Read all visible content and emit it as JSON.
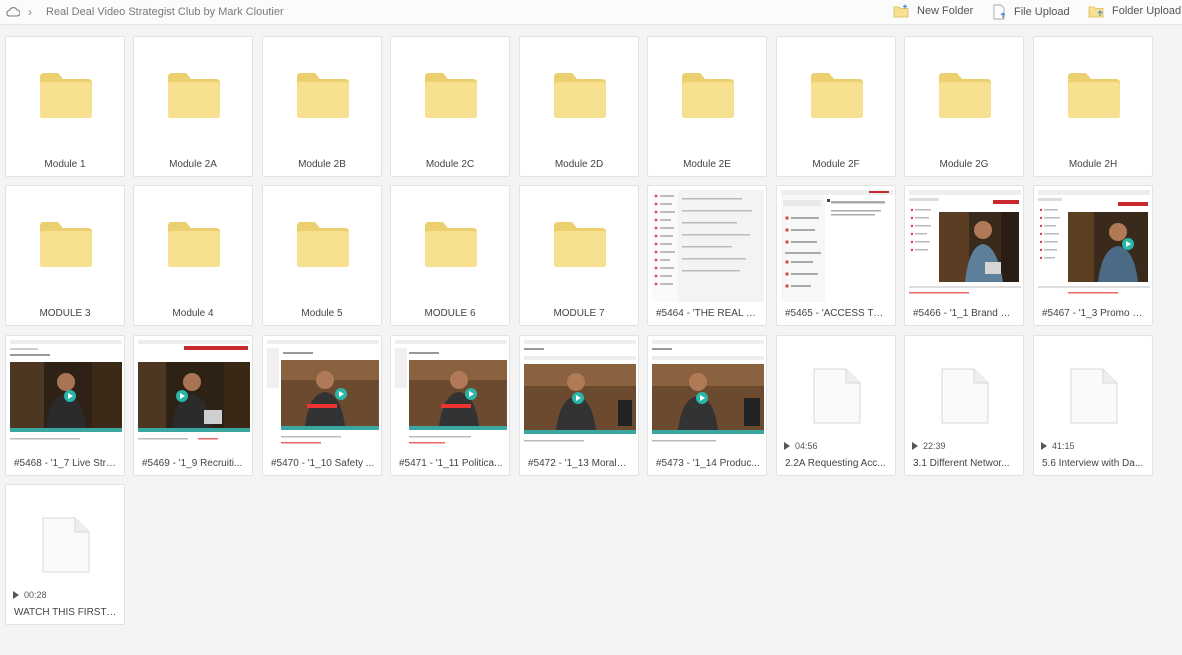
{
  "breadcrumb": {
    "title": "Real Deal Video Strategist Club by Mark Cloutier"
  },
  "toolbar": {
    "new_folder": "New Folder",
    "file_upload": "File Upload",
    "folder_upload": "Folder Upload"
  },
  "colors": {
    "folder": "#f7e08f",
    "folder_dark": "#eccf6e",
    "accent_red": "#c8282d",
    "teal": "#3aa7a0",
    "play_teal": "#29b6a8"
  },
  "folders_row1": [
    "Module 1",
    "Module 2A",
    "Module 2B",
    "Module 2C",
    "Module 2D",
    "Module 2E",
    "Module 2F",
    "Module 2G",
    "Module 2H"
  ],
  "folders_row2": [
    "MODULE 3",
    "Module 4",
    "Module 5",
    "MODULE 6",
    "MODULE 7"
  ],
  "docs_row2": [
    "#5464 - 'THE REAL D...",
    "#5465 - 'ACCESS TO ..."
  ],
  "videos_row2": [
    "#5466 - '1_1 Brand M...",
    "#5467 - '1_3 Promo V..."
  ],
  "videos_row3": [
    "#5468 - '1_7 Live Stre...",
    "#5469 - '1_9 Recruiti...",
    "#5470 - '1_10 Safety ...",
    "#5471 - '1_11 Politica...",
    "#5472 - '1_13 Morale ...",
    "#5473 - '1_14 Produc..."
  ],
  "files": [
    {
      "name": "2.2A Requesting Acc...",
      "duration": "04:56"
    },
    {
      "name": "3.1 Different Networ...",
      "duration": "22:39"
    },
    {
      "name": "5.6 Interview with Da...",
      "duration": "41:15"
    },
    {
      "name": "WATCH THIS FIRST - ...",
      "duration": "00:28"
    }
  ]
}
